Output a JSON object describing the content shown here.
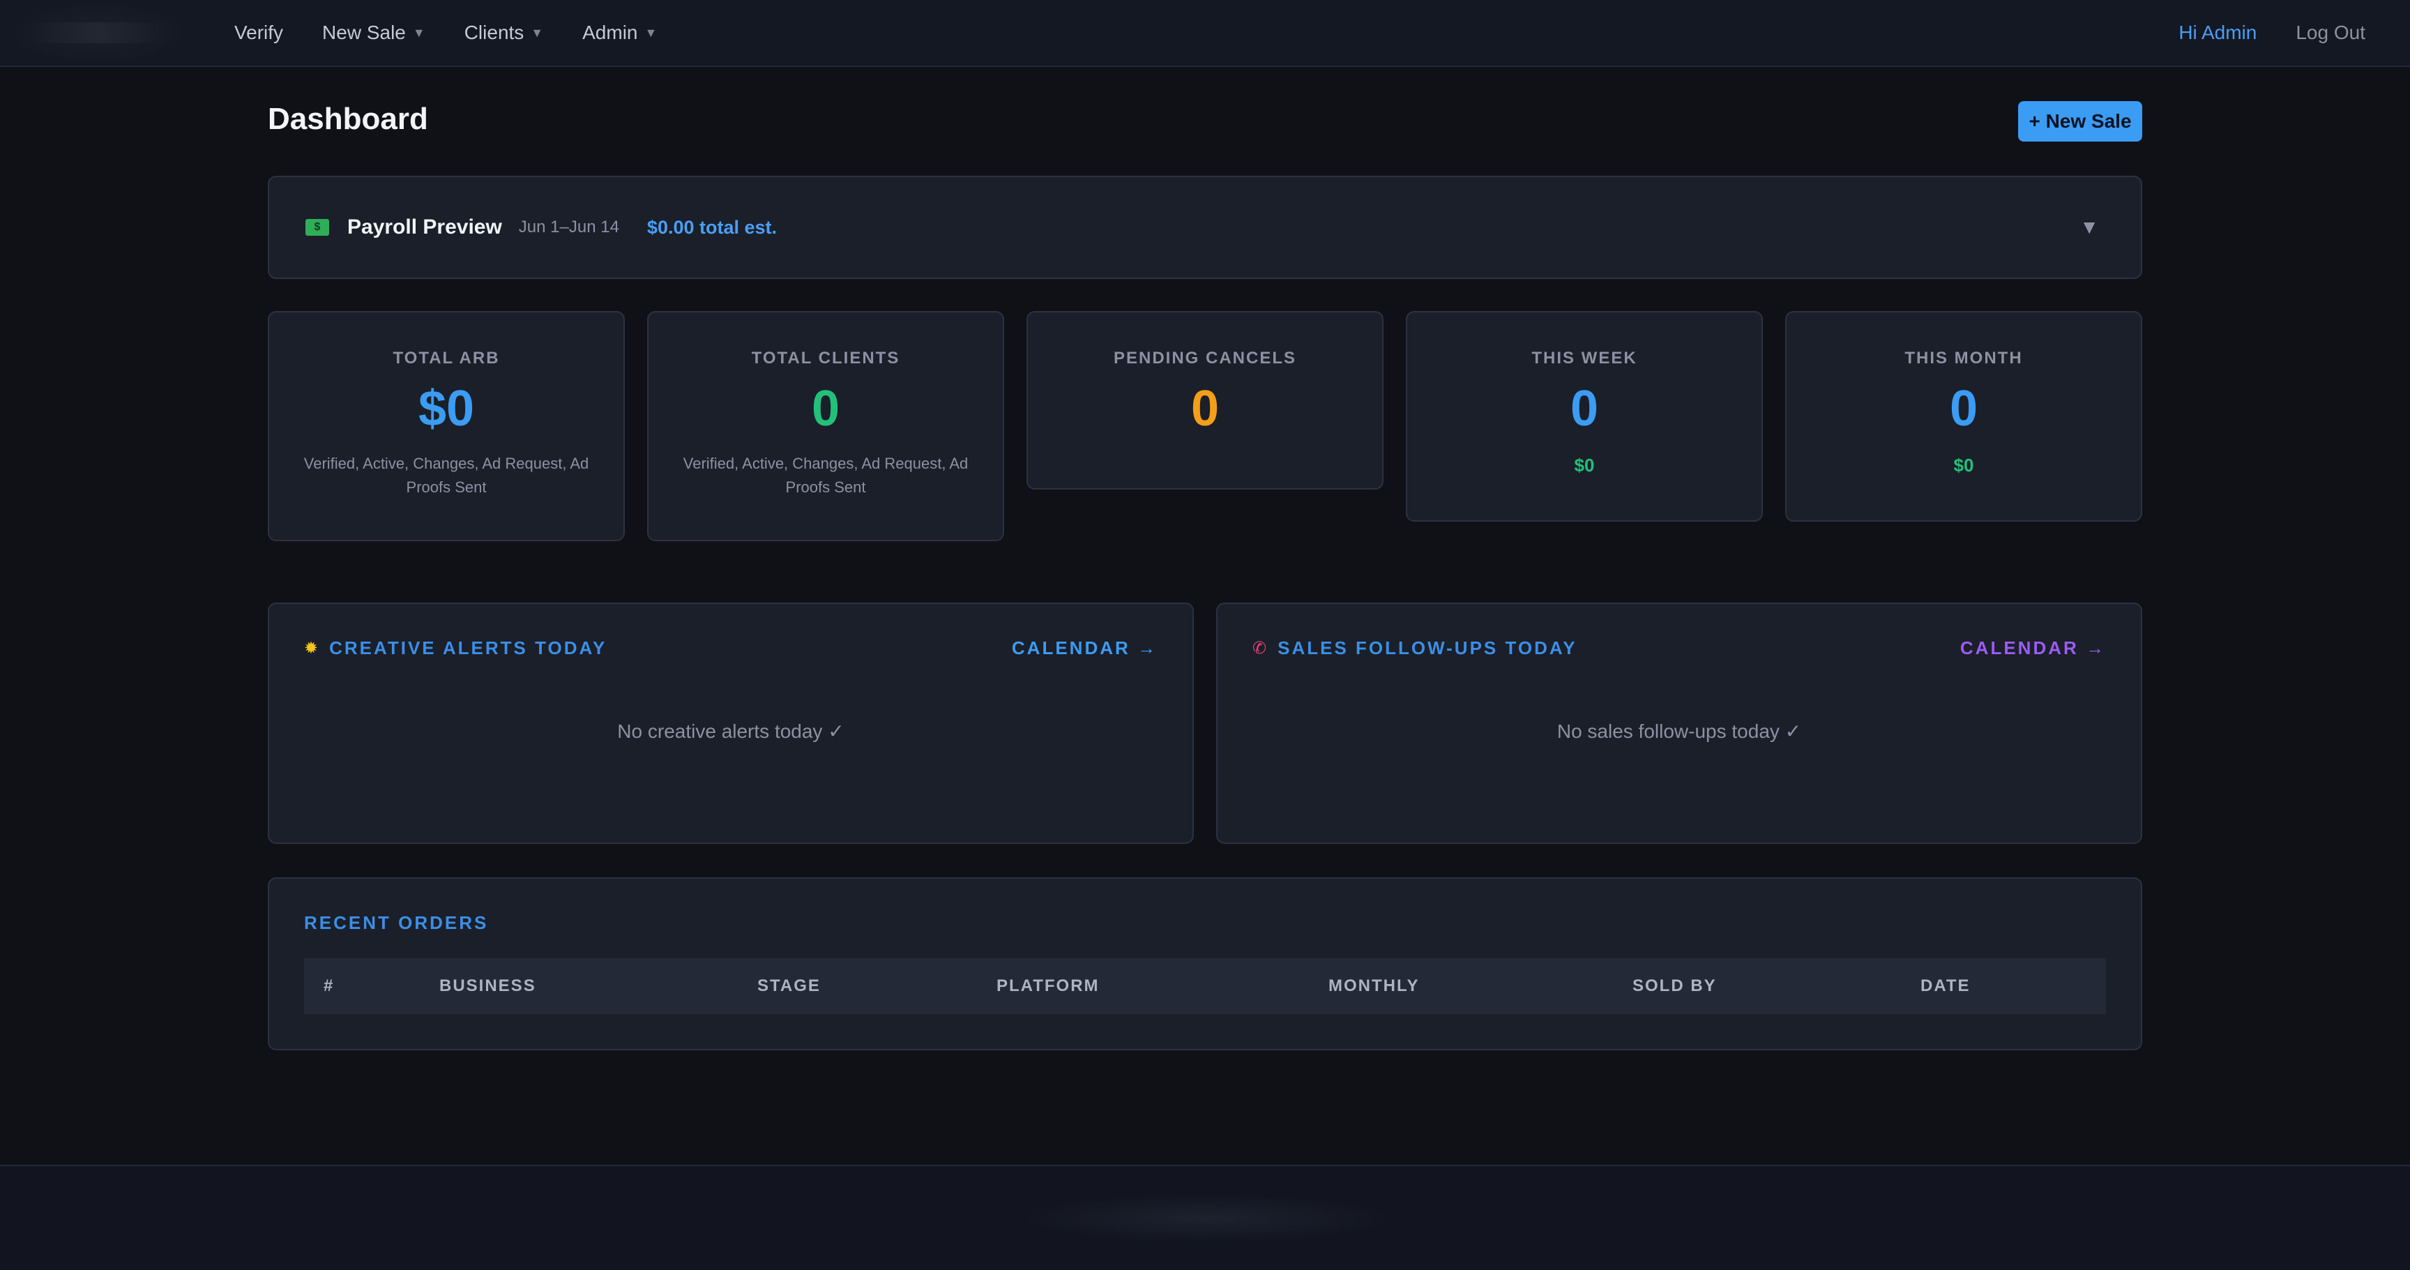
{
  "nav": {
    "links": [
      {
        "label": "Verify",
        "caret": ""
      },
      {
        "label": "New Sale",
        "caret": "▼"
      },
      {
        "label": "Clients",
        "caret": "▼"
      },
      {
        "label": "Admin",
        "caret": "▼"
      }
    ],
    "greeting": "Hi Admin",
    "logout": "Log Out"
  },
  "page": {
    "title": "Dashboard",
    "new_sale_button": "+ New Sale"
  },
  "payroll": {
    "icon": "money-icon",
    "title": "Payroll Preview",
    "dates": "Jun 1–Jun 14",
    "total": "$0.00 total est.",
    "toggle": "▼"
  },
  "stats": [
    {
      "label": "TOTAL ARB",
      "value": "$0",
      "sub": "Verified, Active, Changes, Ad Request, Ad Proofs Sent",
      "color": "#3b9cf4"
    },
    {
      "label": "TOTAL CLIENTS",
      "value": "0",
      "sub": "Verified, Active, Changes, Ad Request, Ad Proofs Sent",
      "color": "#22c07a"
    },
    {
      "label": "PENDING CANCELS",
      "value": "0",
      "color": "#f59e1a"
    },
    {
      "label": "THIS WEEK",
      "value": "0",
      "amount": "$0",
      "color": "#3b9cf4"
    },
    {
      "label": "THIS MONTH",
      "value": "0",
      "amount": "$0",
      "color": "#3b9cf4"
    }
  ],
  "alerts": [
    {
      "icon": "sun-icon",
      "title": "CREATIVE ALERTS TODAY",
      "link": "CALENDAR →",
      "link_color": "#3b9cf4",
      "empty": "No creative alerts today ✓"
    },
    {
      "icon": "phone-icon",
      "title": "SALES FOLLOW-UPS TODAY",
      "link": "CALENDAR →",
      "link_color": "#9b5cf6",
      "empty": "No sales follow-ups today ✓"
    }
  ],
  "orders": {
    "title": "RECENT ORDERS",
    "columns": [
      "#",
      "BUSINESS",
      "STAGE",
      "PLATFORM",
      "MONTHLY",
      "SOLD BY",
      "DATE"
    ]
  }
}
